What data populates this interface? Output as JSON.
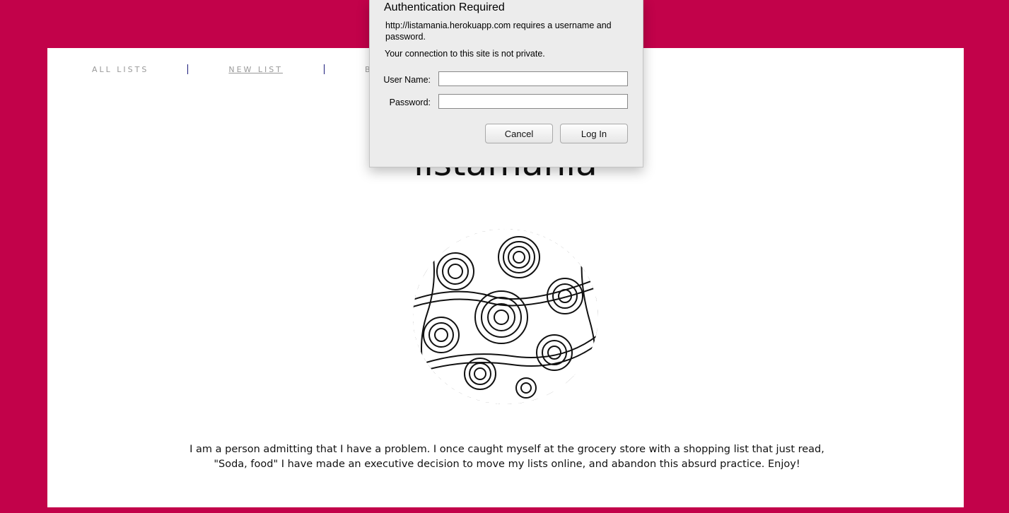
{
  "nav": {
    "items": [
      {
        "label": "ALL LISTS"
      },
      {
        "label": "NEW LIST"
      },
      {
        "label": "BA"
      }
    ]
  },
  "site": {
    "title": "listamania",
    "intro": "I am a person admitting that I have a problem. I once caught myself at the grocery store with a shopping list that just read, \"Soda, food\" I have made an executive decision to move my lists online, and abandon this absurd practice. Enjoy!"
  },
  "dialog": {
    "title": "Authentication Required",
    "message": "http://listamania.herokuapp.com requires a username and password.",
    "privacy_note": "Your connection to this site is not private.",
    "username_label": "User Name:",
    "password_label": "Password:",
    "username_value": "",
    "password_value": "",
    "cancel_label": "Cancel",
    "login_label": "Log In"
  },
  "colors": {
    "background": "#c2024a",
    "page": "#ffffff",
    "dialog": "#ececec"
  }
}
